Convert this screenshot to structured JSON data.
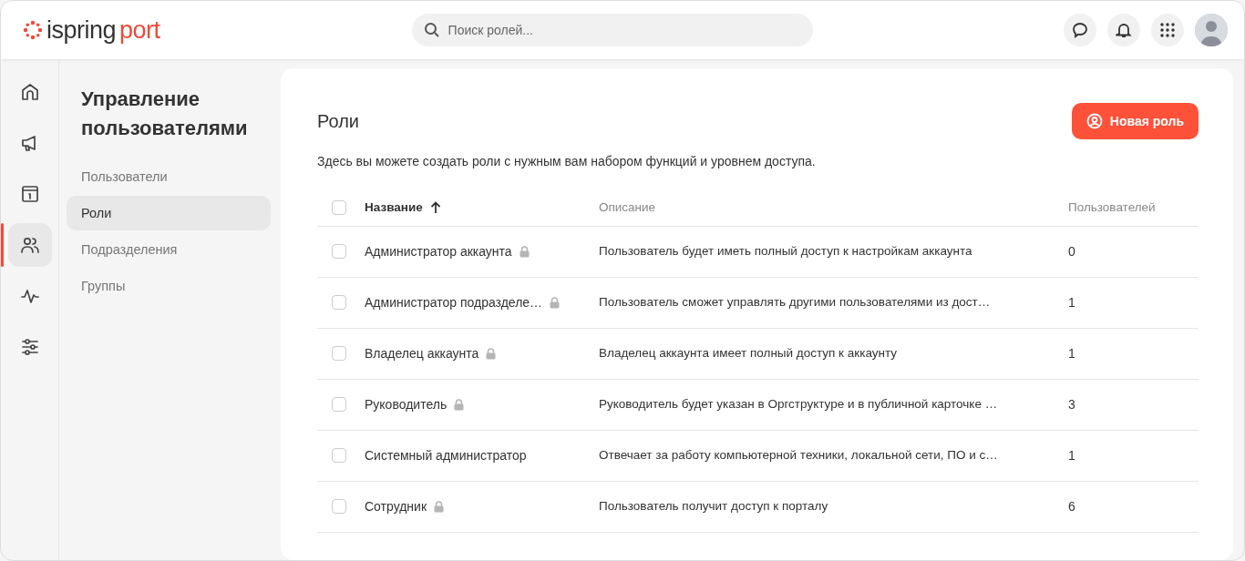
{
  "header": {
    "logo": {
      "part_1": "ispring",
      "part_2": "port"
    },
    "search": {
      "placeholder": "Поиск ролей..."
    }
  },
  "rail": [
    {
      "kind": "home",
      "selected": false
    },
    {
      "kind": "megaphone",
      "selected": false
    },
    {
      "kind": "info",
      "selected": false
    },
    {
      "kind": "users",
      "selected": true
    },
    {
      "kind": "activity",
      "selected": false
    },
    {
      "kind": "sliders",
      "selected": false
    }
  ],
  "sidebar": {
    "title": "Управление пользователями",
    "items": [
      {
        "label": "Пользователи",
        "selected": false
      },
      {
        "label": "Роли",
        "selected": true
      },
      {
        "label": "Подразделения",
        "selected": false
      },
      {
        "label": "Группы",
        "selected": false
      }
    ]
  },
  "page": {
    "title": "Роли",
    "new_button": "Новая роль",
    "description": "Здесь вы можете создать роли с нужным вам набором функций и уровнем доступа."
  },
  "table": {
    "select_all_checked": false,
    "columns": [
      {
        "label": "Название",
        "sorted": true
      },
      {
        "label": "Описание",
        "sorted": false
      },
      {
        "label": "Пользователей",
        "sorted": false
      }
    ],
    "rows": [
      {
        "name": "Администратор аккаунта",
        "locked": true,
        "description": "Пользователь будет иметь полный доступ к настройкам аккаунта",
        "users": "0",
        "checked": false
      },
      {
        "name": "Администратор подразделе…",
        "locked": true,
        "description": "Пользователь сможет управлять другими пользователями из дост…",
        "users": "1",
        "checked": false
      },
      {
        "name": "Владелец аккаунта",
        "locked": true,
        "description": "Владелец аккаунта имеет полный доступ к аккаунту",
        "users": "1",
        "checked": false
      },
      {
        "name": "Руководитель",
        "locked": true,
        "description": "Руководитель будет указан в Оргструктуре и в публичной карточке …",
        "users": "3",
        "checked": false
      },
      {
        "name": "Системный администратор",
        "locked": false,
        "description": "Отвечает за работу компьютерной техники, локальной сети, ПО и с…",
        "users": "1",
        "checked": false
      },
      {
        "name": "Сотрудник",
        "locked": true,
        "description": "Пользователь получит доступ к порталу",
        "users": "6",
        "checked": false
      }
    ]
  }
}
